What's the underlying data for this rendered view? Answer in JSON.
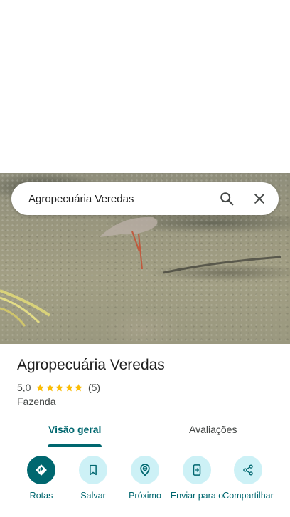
{
  "search": {
    "query": "Agropecuária Veredas"
  },
  "place": {
    "name": "Agropecuária Veredas",
    "rating": "5,0",
    "stars": 5,
    "review_count": "(5)",
    "category": "Fazenda"
  },
  "tabs": {
    "overview": "Visão geral",
    "reviews": "Avaliações",
    "active": "overview"
  },
  "actions": [
    {
      "label": "Rotas",
      "icon": "directions-icon"
    },
    {
      "label": "Salvar",
      "icon": "bookmark-icon"
    },
    {
      "label": "Próximo",
      "icon": "nearby-icon"
    },
    {
      "label": "Enviar para o",
      "icon": "send-to-phone-icon"
    },
    {
      "label": "Compartilhar",
      "icon": "share-icon"
    }
  ],
  "colors": {
    "accent": "#00676f",
    "chip_background": "#cdf1f6",
    "star": "#fbbc04"
  }
}
